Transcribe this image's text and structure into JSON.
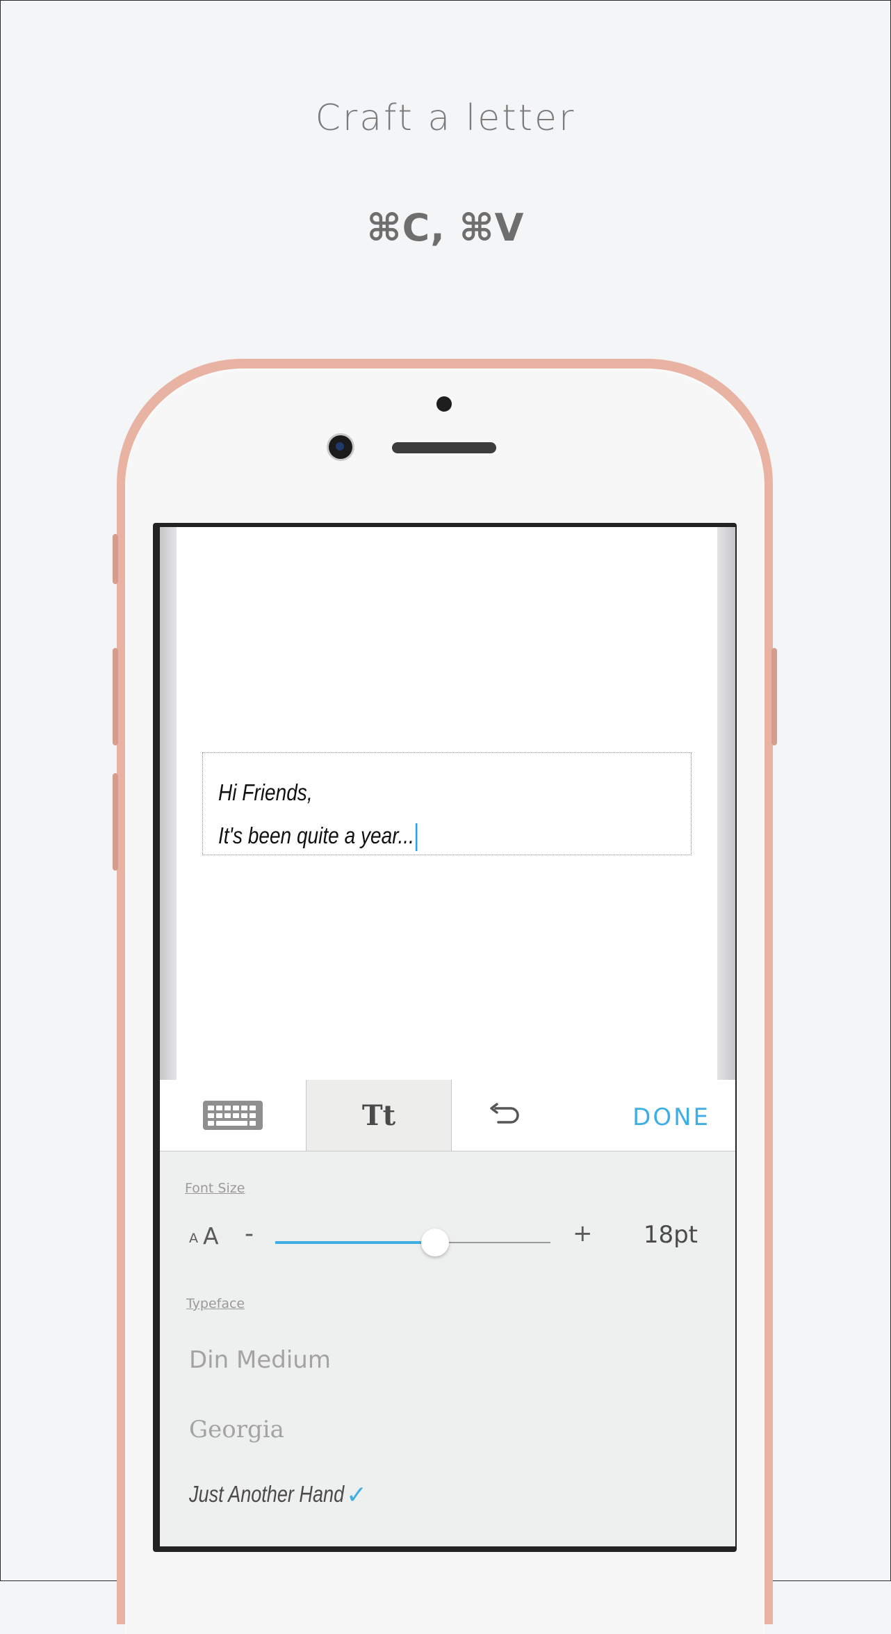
{
  "header": {
    "title": "Craft a letter",
    "subtitle": "⌘C, ⌘V"
  },
  "letter": {
    "line1": "Hi Friends,",
    "line2": "It's been quite a year..."
  },
  "toolbar": {
    "text_tool_label": "Tt",
    "done_label": "DONE"
  },
  "panel": {
    "font_size_label": "Font Size",
    "size_small_glyph": "A",
    "size_big_glyph": "A",
    "decrease_label": "-",
    "increase_label": "+",
    "font_size_value": "18pt",
    "slider_fraction": 0.58,
    "typeface_label": "Typeface",
    "typefaces": [
      {
        "name": "Din Medium",
        "selected": false
      },
      {
        "name": "Georgia",
        "selected": false
      },
      {
        "name": "Just Another Hand",
        "selected": true
      }
    ],
    "check_glyph": "✓"
  },
  "colors": {
    "accent": "#3eaee4",
    "phone_rose": "#e9b3a3",
    "background": "#f4f5f7"
  }
}
